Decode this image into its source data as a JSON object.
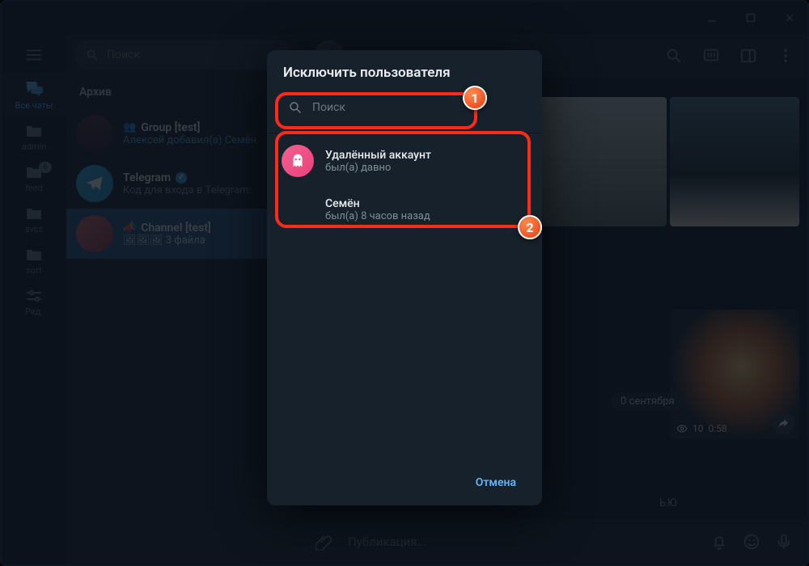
{
  "window": {
    "channel_title": "Channel [test]"
  },
  "rail": {
    "items": [
      {
        "label": "Все чаты",
        "icon": "chat",
        "active": true
      },
      {
        "label": "admin",
        "icon": "folder"
      },
      {
        "label": "feed",
        "icon": "folder",
        "badge": "6"
      },
      {
        "label": "svcs",
        "icon": "folder"
      },
      {
        "label": "sort",
        "icon": "folder"
      },
      {
        "label": "Ред.",
        "icon": "sliders"
      }
    ]
  },
  "sidebar": {
    "search_placeholder": "Поиск",
    "archive_label": "Архив",
    "chats": [
      {
        "title": "Group [test]",
        "subtitle_prefix": "Алексей добавил(а) Семён",
        "icon": "group"
      },
      {
        "title": "Telegram",
        "subtitle": "Код для входа в Telegram: ",
        "verified": true,
        "icon": "telegram"
      },
      {
        "title": "Channel [test]",
        "subtitle": "3 файла",
        "selected": true,
        "icon": "channel",
        "megaphone": true
      }
    ]
  },
  "header_actions": [
    "search",
    "chat",
    "panel",
    "more"
  ],
  "media": {
    "date_chip": "0 сентября",
    "video_stat": {
      "views": "10",
      "time": "0:58"
    },
    "stub": "ЬЮ"
  },
  "compose": {
    "placeholder": "Публикация..."
  },
  "modal": {
    "title": "Исключить пользователя",
    "search_placeholder": "Поиск",
    "users": [
      {
        "name": "Удалённый аккаунт",
        "status": "был(а) давно",
        "avatar": "ghost"
      },
      {
        "name": "Семён",
        "status": "был(а) 8 часов назад",
        "avatar": "none"
      }
    ],
    "cancel": "Отмена"
  },
  "annotations": {
    "one": "1",
    "two": "2"
  }
}
